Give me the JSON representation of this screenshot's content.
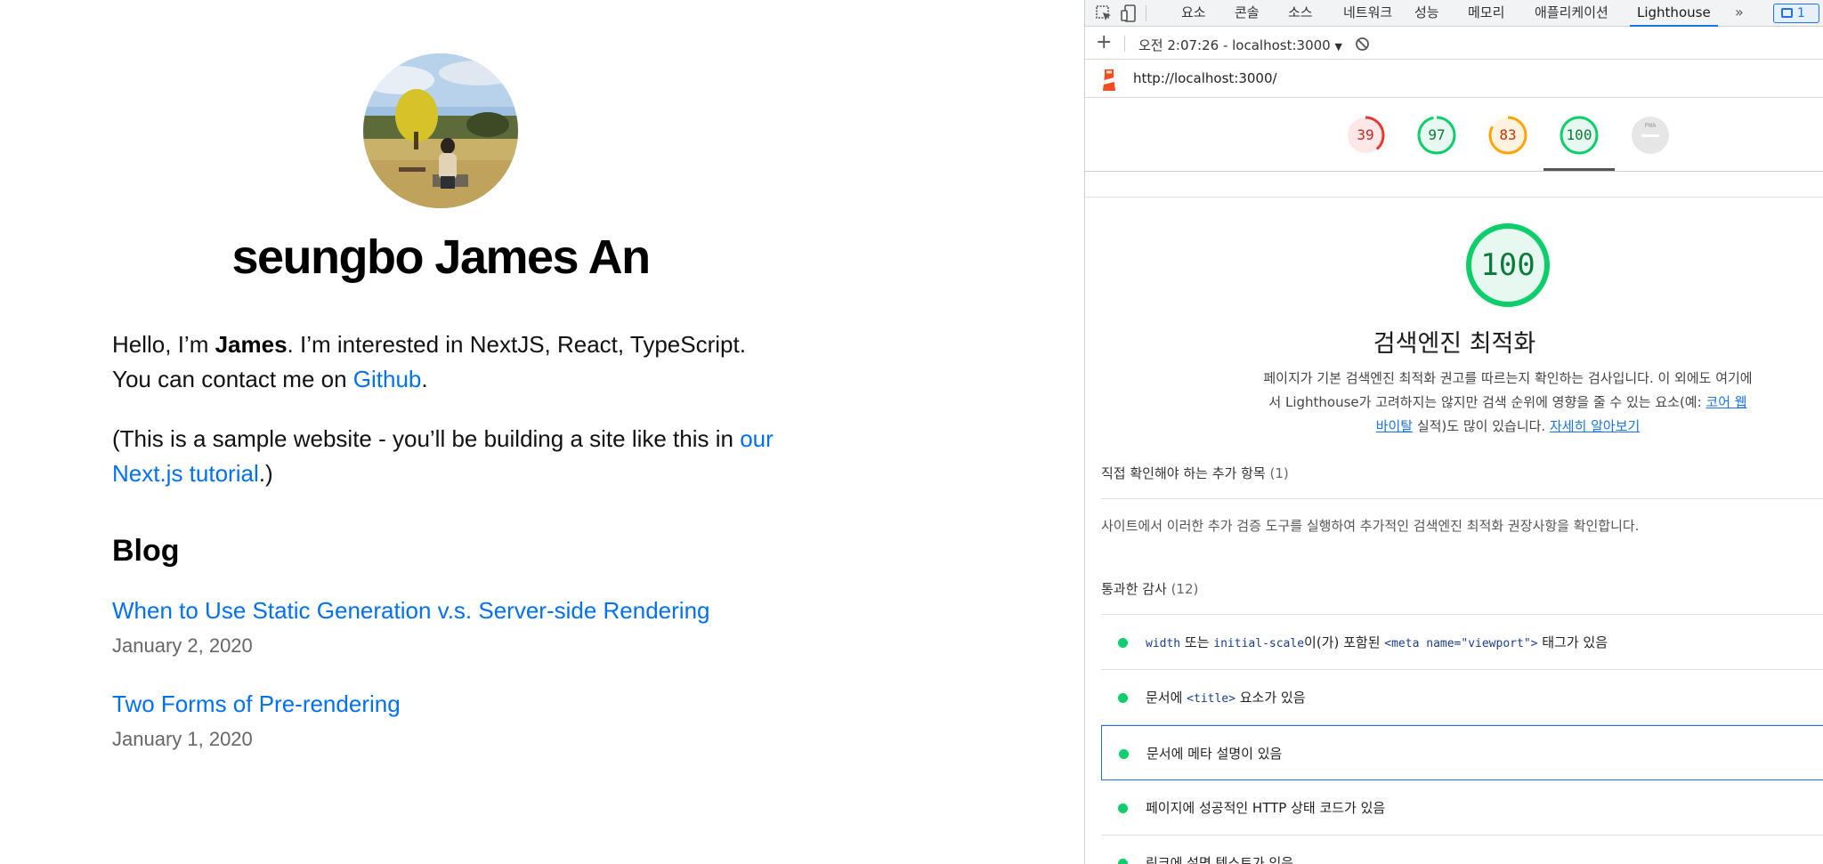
{
  "site": {
    "name": "seungbo James An",
    "intro_pre": "Hello, I’m ",
    "intro_name": "James",
    "intro_mid": ". I’m interested in NextJS, React, TypeScript. You can contact me on ",
    "intro_link": "Github",
    "intro_end": ".",
    "sample_pre": "(This is a sample website - you’ll be building a site like this in ",
    "sample_link": "our Next.js tutorial",
    "sample_end": ".)",
    "blog_heading": "Blog",
    "posts": [
      {
        "title": "When to Use Static Generation v.s. Server-side Rendering",
        "date": "January 2, 2020"
      },
      {
        "title": "Two Forms of Pre-rendering",
        "date": "January 1, 2020"
      }
    ],
    "link_color": "#0070f3"
  },
  "devtools": {
    "tabs": [
      "요소",
      "콘솔",
      "소스",
      "네트워크",
      "성능",
      "메모리",
      "애플리케이션",
      "Lighthouse"
    ],
    "active_tab": "Lighthouse",
    "more_tabs": "»",
    "issues_count": "1",
    "report_selector": "오전 2:07:26 - localhost:3000",
    "url": "http://localhost:3000/",
    "gauges": [
      {
        "value": "39",
        "fraction": 0.39,
        "color": "#e53935",
        "track": "#fde8e7"
      },
      {
        "value": "97",
        "fraction": 0.97,
        "color": "#0cce6b",
        "track": "#e6f8ef"
      },
      {
        "value": "83",
        "fraction": 0.83,
        "color": "#ffa400",
        "track": "#fff3e0"
      },
      {
        "value": "100",
        "fraction": 1.0,
        "color": "#0cce6b",
        "track": "#e6f8ef"
      },
      {
        "value": "PWA",
        "fraction": 0,
        "color": "#bdbdbd",
        "track": "#e6e6e6"
      }
    ],
    "category": {
      "score": "100",
      "title": "검색엔진 최적화",
      "desc_pre": "페이지가 기본 검색엔진 최적화 권고를 따르는지 확인하는 검사입니다. 이 외에도 여기에서 Lighthouse가 고려하지는 않지만 검색 순위에 영향을 줄 수 있는 요소(예: ",
      "desc_link1": "코어 웹 바이탈",
      "desc_mid": " 실적)도 많이 있습니다. ",
      "desc_link2": "자세히 알아보기"
    },
    "manual": {
      "heading": "직접 확인해야 하는 추가 항목",
      "count": "(1)",
      "desc": "사이트에서 이러한 추가 검증 도구를 실행하여 추가적인 검색엔진 최적화 권장사항을 확인합니다."
    },
    "passed": {
      "heading": "통과한 감사",
      "count": "(12)",
      "audits": {
        "a1_code1": "width",
        "a1_t1": " 또는 ",
        "a1_code2": "initial-scale",
        "a1_t2": "이(가) 포함된 ",
        "a1_code3": "<meta name=\"viewport\">",
        "a1_t3": " 태그가 있음",
        "a2_t1": "문서에 ",
        "a2_code": "<title>",
        "a2_t2": " 요소가 있음",
        "a3": "문서에 메타 설명이 있음",
        "a4": "페이지에 성공적인 HTTP 상태 코드가 있음",
        "a5": "링크에 설명 텍스트가 있음"
      }
    }
  }
}
